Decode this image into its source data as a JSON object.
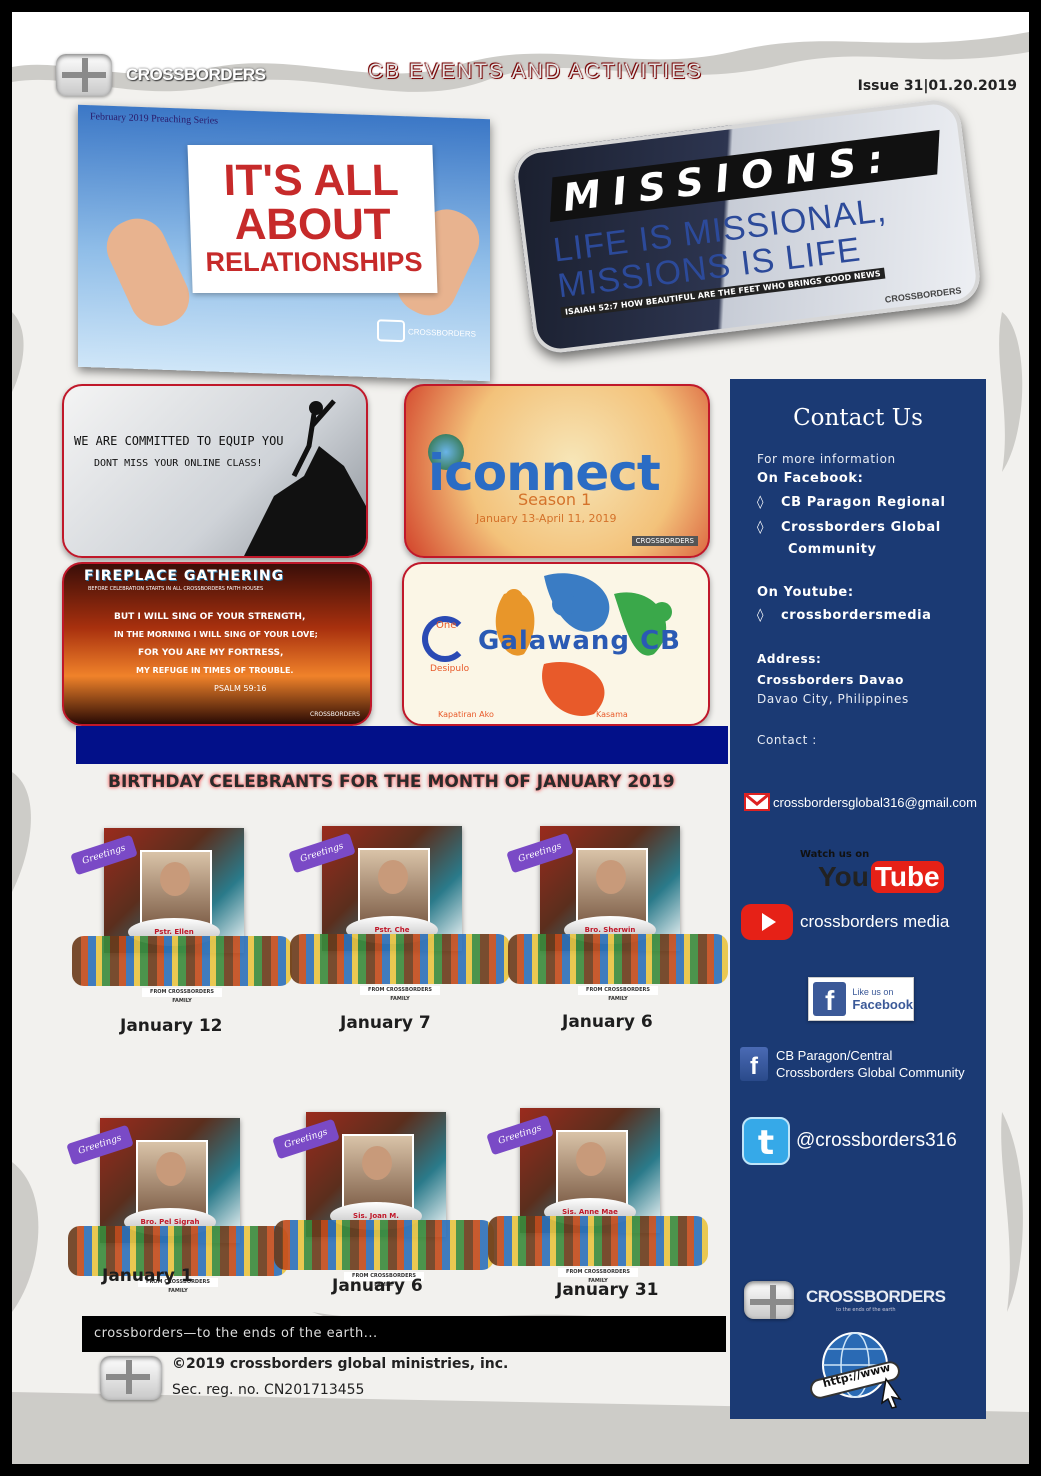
{
  "header": {
    "logo_text": "CROSSBORDERS",
    "banner_title": "CB EVENTS AND ACTIVITIES",
    "issue": "Issue 31|01.20.2019"
  },
  "features": {
    "relationships": {
      "series_label": "February 2019 Preaching Series",
      "line1": "IT'S ALL",
      "line2": "ABOUT",
      "line3": "RELATIONSHIPS",
      "logo_text": "CROSSBORDERS"
    },
    "missions": {
      "headline": "MISSIONS:",
      "line1": "LIFE IS MISSIONAL,",
      "line2": "MISSIONS IS LIFE",
      "verse": "ISAIAH 52:7  HOW BEAUTIFUL ARE THE FEET WHO BRINGS GOOD NEWS",
      "logo_text": "CROSSBORDERS"
    }
  },
  "events": {
    "online_class": {
      "line1": "WE ARE COMMITTED TO EQUIP YOU",
      "line2": "DONT MISS YOUR ONLINE CLASS!"
    },
    "iconnect": {
      "title": "iconnect",
      "season": "Season 1",
      "dates": "January 13-April 11, 2019",
      "logo_text": "CROSSBORDERS"
    },
    "fireplace": {
      "title": "FIREPLACE GATHERING",
      "subtitle": "BEFORE CELEBRATION STARTS IN ALL CROSSBORDERS FAITH HOUSES",
      "line1": "BUT I WILL SING OF YOUR STRENGTH,",
      "line2": "IN THE MORNING I WILL SING OF YOUR LOVE;",
      "line3": "FOR YOU ARE MY FORTRESS,",
      "line4": "MY REFUGE IN TIMES OF TROUBLE.",
      "verse": "PSALM 59:16",
      "logo_text": "CROSSBORDERS"
    },
    "galawang": {
      "title": "Galawang CB",
      "word1": "One",
      "word2": "Desipulo",
      "word3": "Kapatiran Ako",
      "word4": "Kasama"
    }
  },
  "birthdays": {
    "title": "BIRTHDAY CELEBRANTS FOR THE MONTH OF JANUARY 2019",
    "greeting": "Greetings",
    "crowd_label": "FROM CROSSBORDERS FAMILY",
    "items": [
      {
        "name": "Pstr. Ellen",
        "date": "January 12"
      },
      {
        "name": "Pstr. Che",
        "date": "January 7"
      },
      {
        "name": "Bro. Sherwin",
        "date": "January 6"
      },
      {
        "name": "Bro. Pel Sigrah",
        "date": "January 1"
      },
      {
        "name": "Sis. Joan M.",
        "date": "January 6"
      },
      {
        "name": "Sis. Anne Mae",
        "date": "January 31"
      }
    ]
  },
  "footer": {
    "tagline": "crossborders—to the ends of the earth...",
    "copyright": "©2019 crossborders global ministries, inc.",
    "reg": "Sec. reg. no. CN201713455"
  },
  "contact": {
    "title": "Contact Us",
    "more_info": "For more information",
    "facebook_label": "On Facebook:",
    "facebook_items": [
      "CB Paragon Regional",
      "Crossborders Global",
      "Community"
    ],
    "youtube_label": "On Youtube:",
    "youtube_item": "crossbordersmedia",
    "address_label": "Address:",
    "address_line1": "Crossborders Davao",
    "address_line2": "Davao City, Philippines",
    "contact_label": "Contact :",
    "email": "crossbordersglobal316@gmail.com",
    "watch_us": "Watch us on",
    "youtube_you": "You",
    "youtube_tube": "Tube",
    "youtube_channel": "crossborders media",
    "like_us": "Like us on",
    "like_facebook": "Facebook",
    "fb_page_line1": "CB Paragon/Central",
    "fb_page_line2": "Crossborders Global Community",
    "twitter": "@crossborders316",
    "logo_text": "CROSSBORDERS",
    "logo_sub": "to the ends of the earth",
    "web_label": "http://www"
  },
  "colors": {
    "sidebar": "#1b3a74",
    "accent_red": "#c0182a",
    "blue_bar": "#021089",
    "youtube_red": "#e62117",
    "facebook_blue": "#3b5998",
    "twitter_blue": "#1da1f2"
  }
}
